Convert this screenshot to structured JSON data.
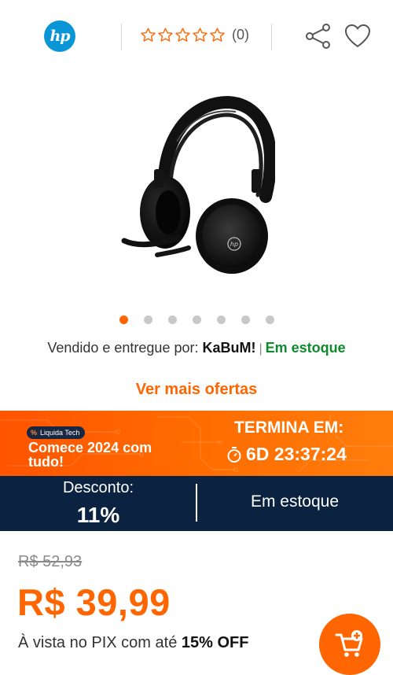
{
  "header": {
    "brand_logo_text": "hp",
    "rating": {
      "stars": 0,
      "max_stars": 5,
      "count_label": "(0)"
    },
    "icons": [
      "share-icon",
      "heart-icon"
    ]
  },
  "gallery": {
    "image_icon": "headset-product-image",
    "total_slides": 7,
    "active_slide": 1
  },
  "seller": {
    "prefix": "Vendido e entregue por:",
    "name": "KaBuM!",
    "separator": "|",
    "stock": "Em estoque"
  },
  "more_offers_label": "Ver mais ofertas",
  "promo": {
    "tag": "Liquida Tech",
    "tag_symbol": "%",
    "title": "Comece 2024 com tudo!",
    "ends_label": "TERMINA EM:",
    "countdown": "6D 23:37:24"
  },
  "info_strip": {
    "discount_label": "Desconto:",
    "discount_value": "11%",
    "stock": "Em estoque"
  },
  "pricing": {
    "old_price": "R$ 52,93",
    "price": "R$ 39,99",
    "pix_prefix": "À vista no PIX com até",
    "pix_discount": "15% OFF"
  },
  "cart_button_icon": "add-to-cart-icon",
  "colors": {
    "accent": "#ff6500",
    "navy": "#0b2340",
    "stock_green": "#0e8a2c",
    "brand_blue": "#0a96d6"
  }
}
